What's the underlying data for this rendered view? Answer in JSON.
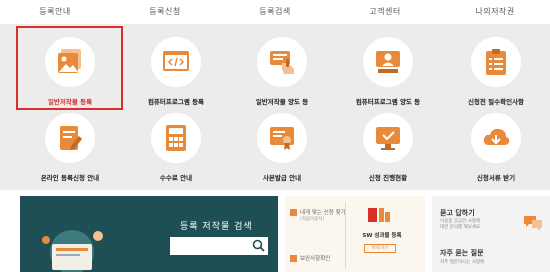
{
  "nav": [
    "등록안내",
    "등록신청",
    "등록검색",
    "고객센터",
    "나의저작권"
  ],
  "tiles_row1": [
    {
      "label": "일반저작물 등록",
      "icon": "picture-icon",
      "selected": true
    },
    {
      "label": "컴퓨터프로그램 등록",
      "icon": "code-window-icon"
    },
    {
      "label": "일반저작물 양도 등",
      "icon": "transfer-hand-icon"
    },
    {
      "label": "컴퓨터프로그램 양도 등",
      "icon": "presenter-icon"
    },
    {
      "label": "신청전 필수확인사항",
      "icon": "clipboard-icon"
    }
  ],
  "tiles_row2": [
    {
      "label": "온라인 등록신청 안내",
      "icon": "edit-document-icon"
    },
    {
      "label": "수수료 안내",
      "icon": "calculator-icon"
    },
    {
      "label": "사본발급 안내",
      "icon": "certificate-icon"
    },
    {
      "label": "신청 진행현황",
      "icon": "monitor-check-icon"
    },
    {
      "label": "신청서류 받기",
      "icon": "cloud-download-icon"
    }
  ],
  "search": {
    "title": "등록 저작물 검색",
    "placeholder": ""
  },
  "mid": {
    "apply_title": "내게 맞는 신청 찾기",
    "apply_sub": "(처음이용자)",
    "sw_label": "SW 성과물 등록",
    "sw_button": "바로가기",
    "supplement": "보완사항확인"
  },
  "right": {
    "qa_title": "묻고 답하기",
    "qa_sub1": "이용중 궁금한 사항에",
    "qa_sub2": "대한 문의를 해보세요",
    "faq_title": "자주 묻는 질문",
    "faq_sub": "자주 질문하시는 사항에"
  },
  "colors": {
    "accent": "#e88a3a",
    "selection": "#d9302c",
    "dark_panel": "#1e4f55"
  }
}
